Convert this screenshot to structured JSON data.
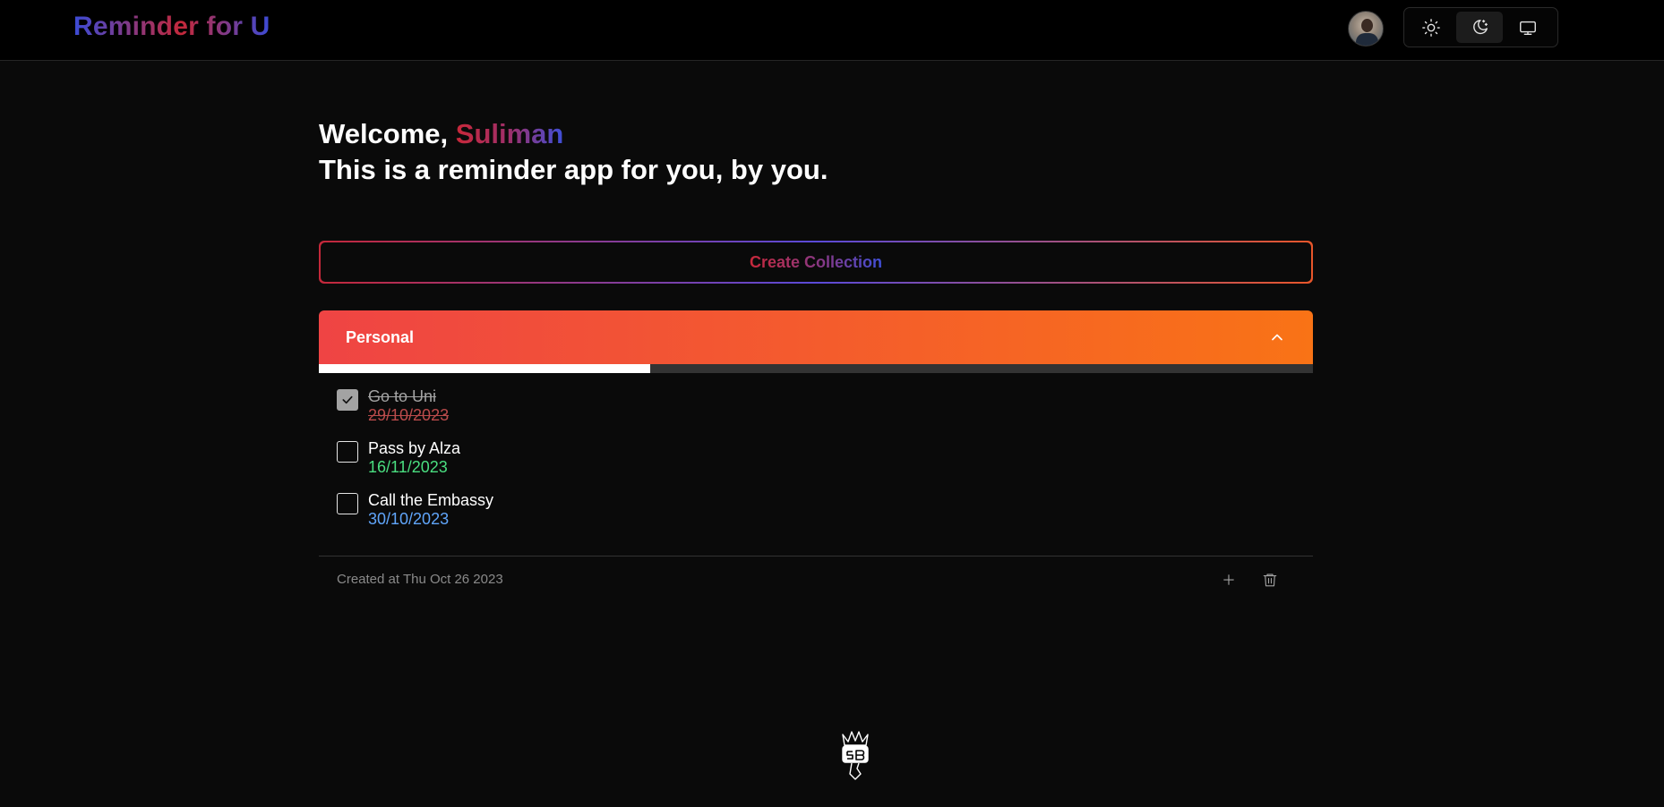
{
  "header": {
    "brand": "Reminder for U",
    "theme_options": [
      "light",
      "dark",
      "system"
    ],
    "active_theme": "dark"
  },
  "welcome": {
    "greeting": "Welcome, ",
    "name": "Suliman",
    "subtitle": "This is a reminder app for you, by you."
  },
  "create_collection": {
    "label": "Create Collection"
  },
  "collection": {
    "title": "Personal",
    "progress": 0.333,
    "colors": {
      "from": "#ef4444",
      "to": "#f97316"
    },
    "tasks": [
      {
        "text": "Go to Uni",
        "date": "29/10/2023",
        "done": true,
        "date_color": "#b94b4b"
      },
      {
        "text": "Pass by Alza",
        "date": "16/11/2023",
        "done": false,
        "date_color": "#4ade80"
      },
      {
        "text": "Call the Embassy",
        "date": "30/10/2023",
        "done": false,
        "date_color": "#60a5fa"
      }
    ],
    "created": "Created at Thu Oct 26 2023"
  },
  "icons": {
    "light": "sun-icon",
    "dark": "moon-icon",
    "system": "monitor-icon",
    "collapse": "chevron-up-icon",
    "add": "plus-icon",
    "delete": "trash-icon",
    "footer_logo": "sb-logo"
  }
}
